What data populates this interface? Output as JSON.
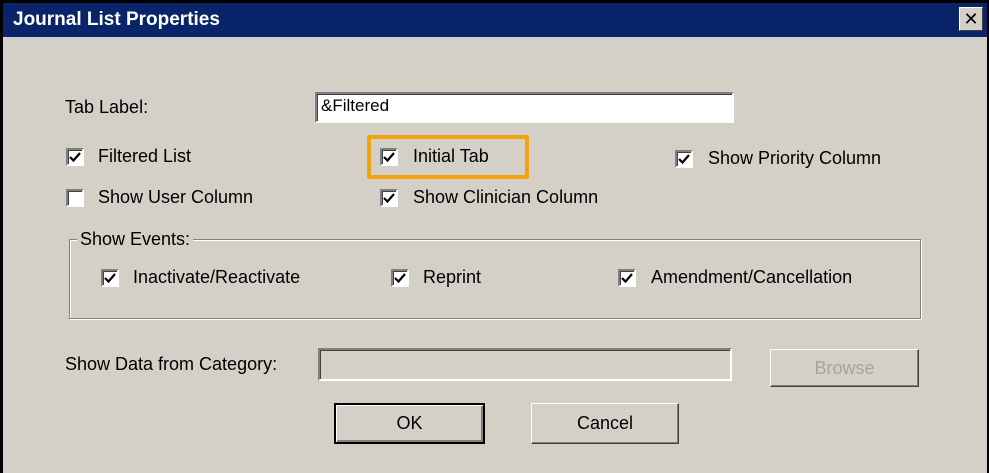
{
  "dialog": {
    "title": "Journal List Properties",
    "close_symbol": "✕",
    "tab_label": {
      "label": "Tab Label:",
      "value": "&Filtered"
    },
    "checkboxes": {
      "filtered_list": {
        "label": "Filtered List",
        "checked": true
      },
      "initial_tab": {
        "label": "Initial Tab",
        "checked": true
      },
      "show_priority_column": {
        "label": "Show Priority Column",
        "checked": true
      },
      "show_user_column": {
        "label": "Show User Column",
        "checked": false
      },
      "show_clinician_column": {
        "label": "Show Clinician Column",
        "checked": true
      }
    },
    "events_group": {
      "label": "Show Events:",
      "inactivate": {
        "label": "Inactivate/Reactivate",
        "checked": true
      },
      "reprint": {
        "label": "Reprint",
        "checked": true
      },
      "amendment": {
        "label": "Amendment/Cancellation",
        "checked": true
      }
    },
    "category": {
      "label": "Show Data from Category:",
      "value": "",
      "browse_label": "Browse"
    },
    "buttons": {
      "ok": "OK",
      "cancel": "Cancel"
    },
    "highlight_color": "#f0a30a",
    "titlebar_color": "#0a246a"
  }
}
